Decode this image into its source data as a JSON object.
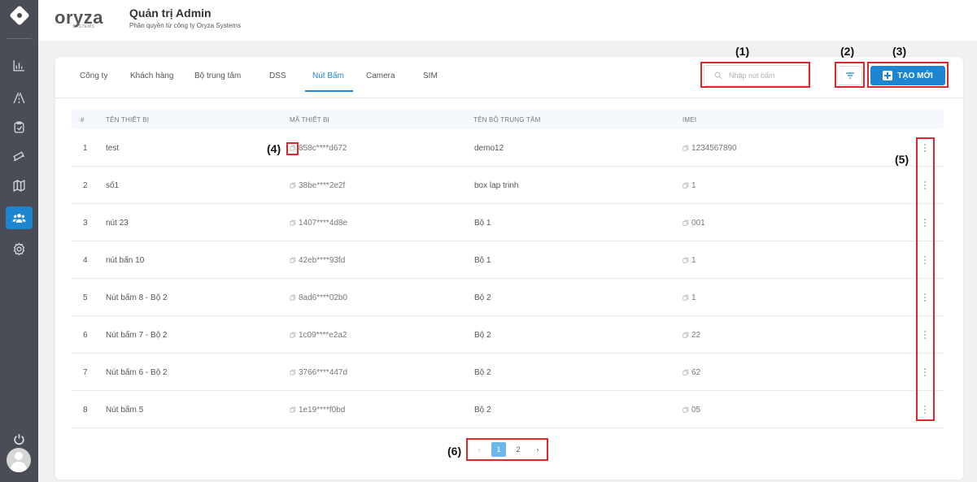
{
  "header": {
    "brand": "oryza",
    "brand_sub": "SYSTEMS",
    "title": "Quản trị Admin",
    "subtitle": "Phân quyền từ công ty Oryza Systems"
  },
  "sidebar": {
    "items": [
      {
        "icon": "chart-icon"
      },
      {
        "icon": "road-icon"
      },
      {
        "icon": "clipboard-icon"
      },
      {
        "icon": "camera-icon"
      },
      {
        "icon": "map-icon"
      },
      {
        "icon": "users-icon",
        "active": true
      },
      {
        "icon": "gear-icon"
      }
    ],
    "power_icon": "power-icon",
    "avatar_icon": "avatar-icon"
  },
  "tabs": [
    "Công ty",
    "Khách hàng",
    "Bộ trung tâm",
    "DSS",
    "Nút Bấm",
    "Camera",
    "SIM"
  ],
  "active_tab": "Nút Bấm",
  "search": {
    "placeholder": "Nhập nút bấm",
    "value": ""
  },
  "create_label": "TẠO MỚI",
  "table": {
    "headers": [
      "#",
      "TÊN THIẾT BỊ",
      "MÃ THIẾT BỊ",
      "TÊN BỘ TRUNG TÂM",
      "IMEI"
    ],
    "rows": [
      {
        "n": "1",
        "name": "test",
        "code": "858c****d672",
        "center": "demo12",
        "imei": "1234567890"
      },
      {
        "n": "2",
        "name": "số1",
        "code": "38be****2e2f",
        "center": "box lap trinh",
        "imei": "1"
      },
      {
        "n": "3",
        "name": "nút 23",
        "code": "1407****4d8e",
        "center": "Bộ 1",
        "imei": "001"
      },
      {
        "n": "4",
        "name": "nút bấn 10",
        "code": "42eb****93fd",
        "center": "Bộ 1",
        "imei": "1"
      },
      {
        "n": "5",
        "name": "Nút bấm 8 - Bộ 2",
        "code": "8ad6****02b0",
        "center": "Bộ 2",
        "imei": "1"
      },
      {
        "n": "6",
        "name": "Nút bấm 7 - Bộ 2",
        "code": "1c09****e2a2",
        "center": "Bộ 2",
        "imei": "22"
      },
      {
        "n": "7",
        "name": "Nút bấm 6 - Bộ 2",
        "code": "3766****447d",
        "center": "Bộ 2",
        "imei": "62"
      },
      {
        "n": "8",
        "name": "Nút bấm 5",
        "code": "1e19****f0bd",
        "center": "Bộ 2",
        "imei": "05"
      }
    ]
  },
  "pagination": {
    "prev": "‹",
    "pages": [
      "1",
      "2"
    ],
    "current": "1",
    "next": "›"
  },
  "annotations": [
    "(1)",
    "(2)",
    "(3)",
    "(4)",
    "(5)",
    "(6)"
  ],
  "colors": {
    "accent": "#1e86d1",
    "sidebar": "#4a4d55",
    "annotation": "#e0262b"
  }
}
